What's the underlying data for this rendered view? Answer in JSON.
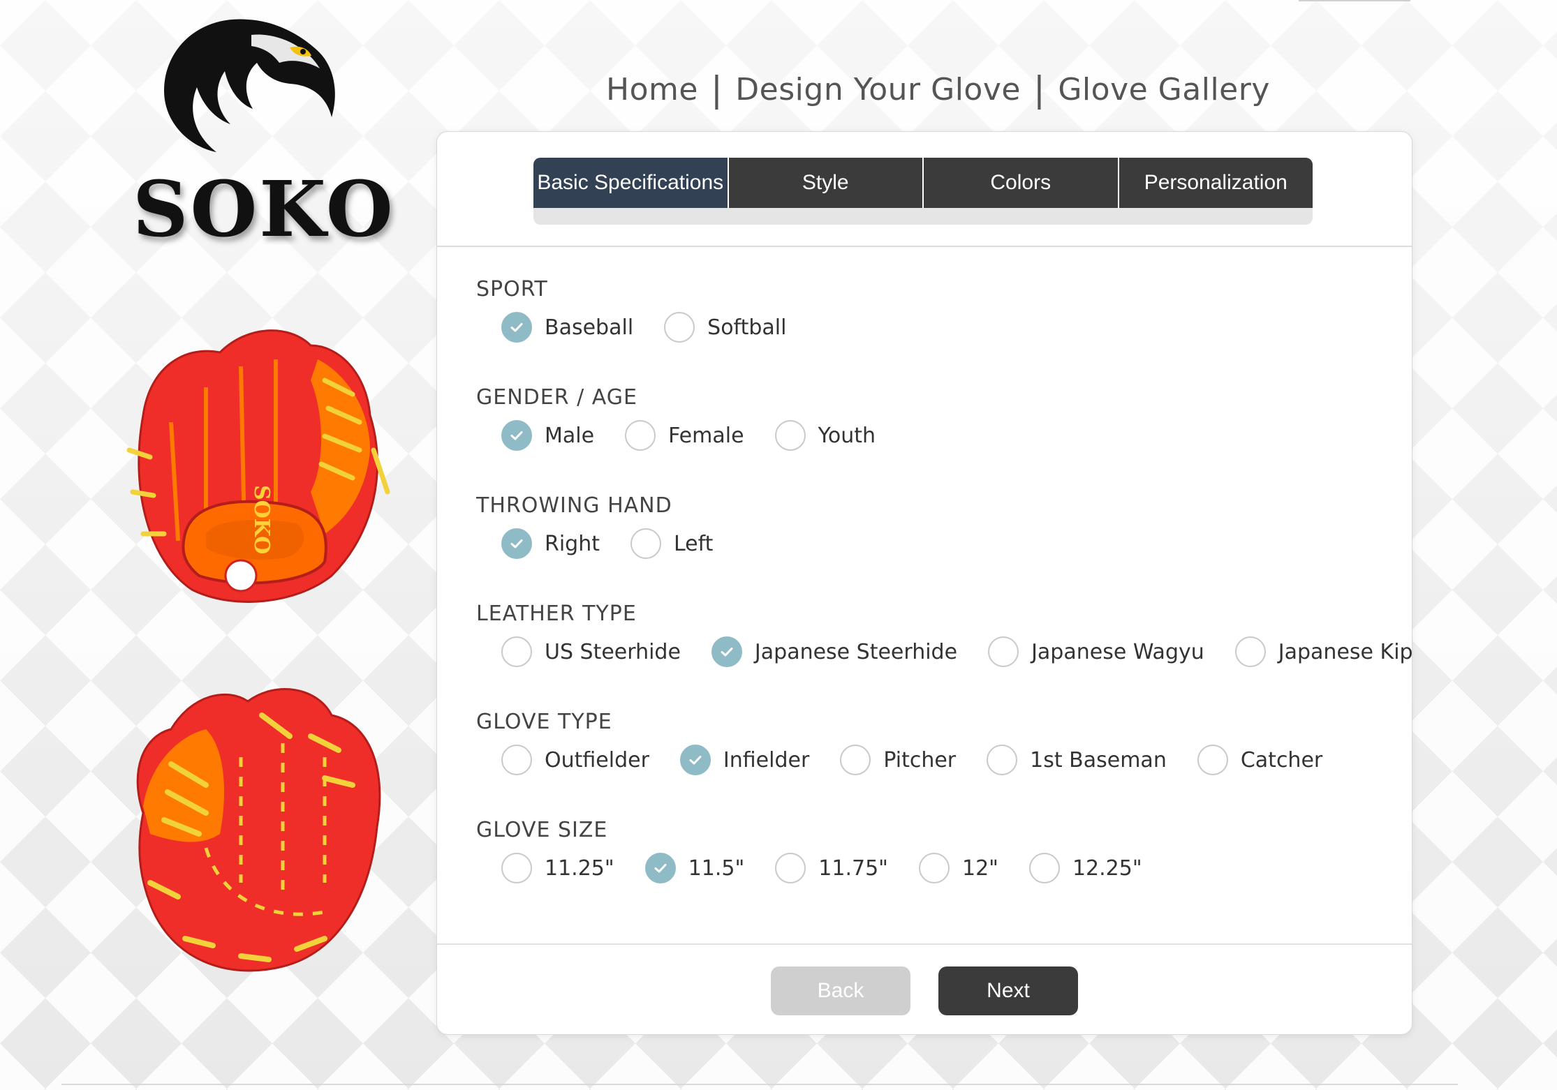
{
  "brand": {
    "logo_text": "SOKO",
    "glove_logo_text": "SOKO"
  },
  "nav": {
    "home": "Home",
    "sep": "|",
    "design": "Design Your Glove",
    "gallery": "Glove Gallery"
  },
  "tabs": [
    "Basic Specifications",
    "Style",
    "Colors",
    "Personalization"
  ],
  "active_tab": "Basic Specifications",
  "sections": [
    {
      "title": "SPORT",
      "options": [
        "Baseball",
        "Softball"
      ],
      "selected": 0
    },
    {
      "title": "GENDER / AGE",
      "options": [
        "Male",
        "Female",
        "Youth"
      ],
      "selected": 0
    },
    {
      "title": "THROWING HAND",
      "options": [
        "Right",
        "Left"
      ],
      "selected": 0
    },
    {
      "title": "LEATHER TYPE",
      "options": [
        "US Steerhide",
        "Japanese Steerhide",
        "Japanese Wagyu",
        "Japanese Kip"
      ],
      "selected": 1
    },
    {
      "title": "GLOVE TYPE",
      "options": [
        "Outfielder",
        "Infielder",
        "Pitcher",
        "1st Baseman",
        "Catcher"
      ],
      "selected": 1
    },
    {
      "title": "GLOVE SIZE",
      "options": [
        "11.25\"",
        "11.5\"",
        "11.75\"",
        "12\"",
        "12.25\""
      ],
      "selected": 1
    }
  ],
  "buttons": {
    "back": "Back",
    "next": "Next"
  },
  "colors": {
    "glove_red": "#ef2e2a",
    "glove_orange": "#ff7a00",
    "lace_yellow": "#f2d23a",
    "accent_teal": "#8fbbc7",
    "tab_active": "#324153",
    "tab_dark": "#3b3b3b"
  }
}
